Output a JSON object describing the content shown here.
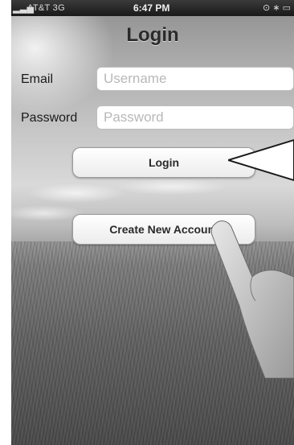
{
  "status_bar": {
    "carrier": "AT&T 3G",
    "time": "6:47 PM"
  },
  "nav": {
    "title": "Login"
  },
  "form": {
    "email_label": "Email",
    "email_placeholder": "Username",
    "password_label": "Password",
    "password_placeholder": "Password"
  },
  "buttons": {
    "login": "Login",
    "create_account": "Create New Account"
  }
}
